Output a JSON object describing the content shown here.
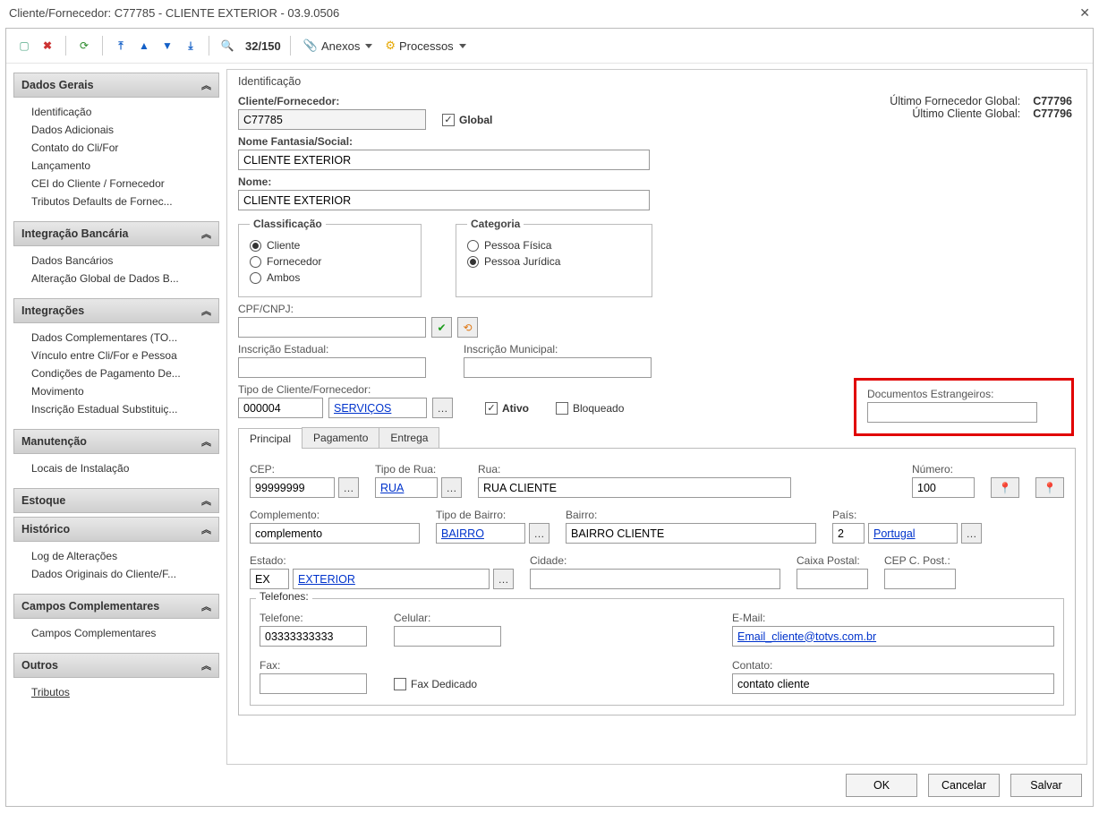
{
  "window": {
    "title": "Cliente/Fornecedor: C77785 - CLIENTE EXTERIOR - 03.9.0506"
  },
  "toolbar": {
    "record_position": "32/150",
    "anexos_label": "Anexos",
    "processos_label": "Processos"
  },
  "sidebar": {
    "groups": [
      {
        "title": "Dados Gerais",
        "items": [
          "Identificação",
          "Dados Adicionais",
          "Contato do Cli/For",
          "Lançamento",
          "CEI do Cliente / Fornecedor",
          "Tributos Defaults de Fornec..."
        ]
      },
      {
        "title": "Integração Bancária",
        "items": [
          "Dados Bancários",
          "Alteração Global de Dados B..."
        ]
      },
      {
        "title": "Integrações",
        "items": [
          "Dados Complementares (TO...",
          "Vínculo entre Cli/For e Pessoa",
          "Condições de Pagamento De...",
          "Movimento",
          "Inscrição Estadual Substituiç..."
        ]
      },
      {
        "title": "Manutenção",
        "items": [
          "Locais de Instalação"
        ]
      },
      {
        "title": "Estoque",
        "items": []
      },
      {
        "title": "Histórico",
        "items": [
          "Log de Alterações",
          "Dados Originais do Cliente/F..."
        ]
      },
      {
        "title": "Campos Complementares",
        "items": [
          "Campos Complementares"
        ]
      },
      {
        "title": "Outros",
        "items": [
          "Tributos"
        ],
        "linkItems": true
      }
    ]
  },
  "main": {
    "section_title": "Identificação",
    "labels": {
      "cliente_fornecedor": "Cliente/Fornecedor:",
      "global": "Global",
      "nome_fantasia": "Nome Fantasia/Social:",
      "nome": "Nome:",
      "classificacao_legend": "Classificação",
      "categoria_legend": "Categoria",
      "cpf_cnpj": "CPF/CNPJ:",
      "insc_estadual": "Inscrição Estadual:",
      "insc_municipal": "Inscrição Municipal:",
      "tipo_cliente_fornecedor": "Tipo de Cliente/Fornecedor:",
      "ativo": "Ativo",
      "bloqueado": "Bloqueado",
      "doc_estrangeiros": "Documentos Estrangeiros:"
    },
    "values": {
      "codigo": "C77785",
      "global_checked": true,
      "nome_fantasia": "CLIENTE EXTERIOR",
      "nome": "CLIENTE EXTERIOR",
      "classificacao": {
        "cliente": "Cliente",
        "fornecedor": "Fornecedor",
        "ambos": "Ambos",
        "selected": "cliente"
      },
      "categoria": {
        "pessoa_fisica": "Pessoa Física",
        "pessoa_juridica": "Pessoa Jurídica",
        "selected": "pessoa_juridica"
      },
      "cpf_cnpj": "",
      "insc_estadual": "",
      "insc_municipal": "",
      "tipo_codigo": "000004",
      "tipo_desc": "SERVIÇOS",
      "ativo_checked": true,
      "bloqueado_checked": false,
      "doc_estrangeiros": ""
    },
    "info_right": {
      "ultimo_fornecedor_label": "Último Fornecedor Global:",
      "ultimo_fornecedor_value": "C77796",
      "ultimo_cliente_label": "Último Cliente Global:",
      "ultimo_cliente_value": "C77796"
    },
    "tabs": {
      "principal": "Principal",
      "pagamento": "Pagamento",
      "entrega": "Entrega",
      "active": "principal"
    },
    "endereco": {
      "labels": {
        "cep": "CEP:",
        "tipo_rua": "Tipo de Rua:",
        "rua": "Rua:",
        "numero": "Número:",
        "complemento": "Complemento:",
        "tipo_bairro": "Tipo de Bairro:",
        "bairro": "Bairro:",
        "pais": "País:",
        "estado": "Estado:",
        "cidade": "Cidade:",
        "caixa_postal": "Caixa Postal:",
        "cep_cpostal": "CEP C. Post.:"
      },
      "values": {
        "cep": "99999999",
        "tipo_rua": "RUA",
        "rua": "RUA CLIENTE",
        "numero": "100",
        "complemento": "complemento",
        "tipo_bairro": "BAIRRO",
        "bairro": "BAIRRO CLIENTE",
        "pais_cod": "2",
        "pais_nome": "Portugal",
        "estado_cod": "EX",
        "estado_nome": "EXTERIOR",
        "cidade": "",
        "caixa_postal": "",
        "cep_cpostal": ""
      }
    },
    "telefones": {
      "legend": "Telefones:",
      "labels": {
        "telefone": "Telefone:",
        "celular": "Celular:",
        "fax": "Fax:",
        "fax_dedicado": "Fax Dedicado",
        "email": "E-Mail:",
        "contato": "Contato:"
      },
      "values": {
        "telefone": "03333333333",
        "celular": "",
        "fax": "",
        "fax_dedicado_checked": false,
        "email": "Email_cliente@totvs.com.br",
        "contato": "contato cliente"
      }
    }
  },
  "footer": {
    "ok": "OK",
    "cancelar": "Cancelar",
    "salvar": "Salvar"
  }
}
